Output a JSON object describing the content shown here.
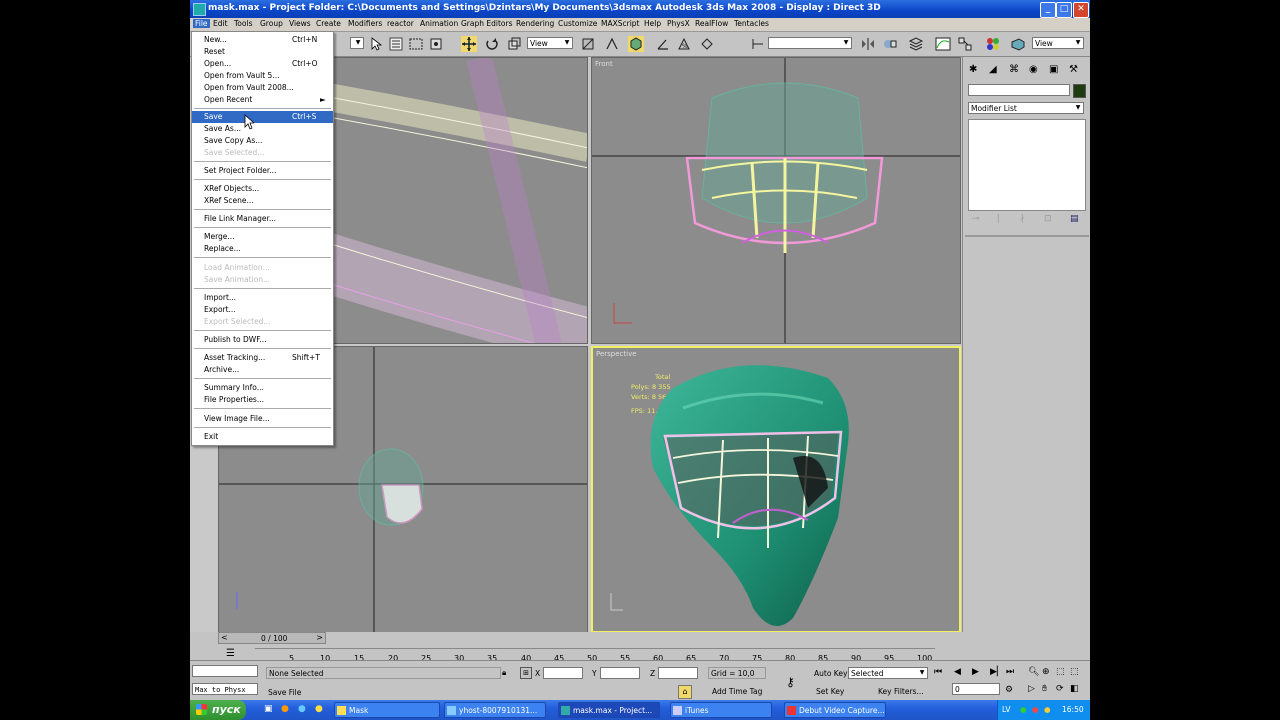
{
  "window": {
    "title": "mask.max     - Project Folder: C:\\Documents and Settings\\Dzintars\\My Documents\\3dsmax        Autodesk 3ds Max 2008        - Display : Direct 3D",
    "minimize": "_",
    "maximize": "□",
    "close": "✕"
  },
  "menubar": [
    "File",
    "Edit",
    "Tools",
    "Group",
    "Views",
    "Create",
    "Modifiers",
    "reactor",
    "Animation",
    "Graph Editors",
    "Rendering",
    "Customize",
    "MAXScript",
    "Help",
    "PhysX",
    "RealFlow",
    "Tentacles"
  ],
  "toolbar": {
    "view_combo": "View",
    "view_combo_right": "View"
  },
  "file_menu": [
    {
      "label": "New...",
      "shortcut": "Ctrl+N",
      "enabled": true
    },
    {
      "label": "Reset",
      "shortcut": "",
      "enabled": true
    },
    {
      "label": "Open...",
      "shortcut": "Ctrl+O",
      "enabled": true
    },
    {
      "label": "Open from Vault 5...",
      "shortcut": "",
      "enabled": true
    },
    {
      "label": "Open from Vault 2008...",
      "shortcut": "",
      "enabled": true
    },
    {
      "label": "Open Recent",
      "shortcut": "►",
      "enabled": true
    },
    {
      "label": "Save",
      "shortcut": "Ctrl+S",
      "enabled": true,
      "highlighted": true
    },
    {
      "label": "Save As...",
      "shortcut": "",
      "enabled": true
    },
    {
      "label": "Save Copy As...",
      "shortcut": "",
      "enabled": true
    },
    {
      "label": "Save Selected...",
      "shortcut": "",
      "enabled": false
    },
    {
      "label": "Set Project Folder...",
      "shortcut": "",
      "enabled": true
    },
    {
      "label": "XRef Objects...",
      "shortcut": "",
      "enabled": true
    },
    {
      "label": "XRef Scene...",
      "shortcut": "",
      "enabled": true
    },
    {
      "label": "File Link Manager...",
      "shortcut": "",
      "enabled": true
    },
    {
      "label": "Merge...",
      "shortcut": "",
      "enabled": true
    },
    {
      "label": "Replace...",
      "shortcut": "",
      "enabled": true
    },
    {
      "label": "Load Animation...",
      "shortcut": "",
      "enabled": false
    },
    {
      "label": "Save Animation...",
      "shortcut": "",
      "enabled": false
    },
    {
      "label": "Import...",
      "shortcut": "",
      "enabled": true
    },
    {
      "label": "Export...",
      "shortcut": "",
      "enabled": true
    },
    {
      "label": "Export Selected...",
      "shortcut": "",
      "enabled": false
    },
    {
      "label": "Publish to DWF...",
      "shortcut": "",
      "enabled": true
    },
    {
      "label": "Asset Tracking...",
      "shortcut": "Shift+T",
      "enabled": true
    },
    {
      "label": "Archive...",
      "shortcut": "",
      "enabled": true
    },
    {
      "label": "Summary Info...",
      "shortcut": "",
      "enabled": true
    },
    {
      "label": "File Properties...",
      "shortcut": "",
      "enabled": true
    },
    {
      "label": "View Image File...",
      "shortcut": "",
      "enabled": true
    },
    {
      "label": "Exit",
      "shortcut": "",
      "enabled": true
    }
  ],
  "viewports": {
    "front": "Front",
    "perspective": "Perspective",
    "stats": {
      "total_label": "Total",
      "polys_label": "Polys:",
      "polys_value": "8 355",
      "verts_label": "Verts:",
      "verts_value": "8 565",
      "fps_label": "FPS:",
      "fps_value": "11.63 307"
    }
  },
  "command_panel": {
    "name_field": "",
    "modifier_list": "Modifier List"
  },
  "timeline": {
    "frame_counter": "0 / 100",
    "ticks": [
      "5",
      "10",
      "15",
      "20",
      "25",
      "30",
      "35",
      "40",
      "45",
      "50",
      "55",
      "60",
      "65",
      "70",
      "75",
      "80",
      "85",
      "90",
      "95",
      "100"
    ]
  },
  "status": {
    "selection": "None Selected",
    "prompt": "Save File",
    "maxscript": "Max to Physx",
    "x_label": "X",
    "y_label": "Y",
    "z_label": "Z",
    "grid": "Grid = 10,0",
    "add_time_tag": "Add Time Tag",
    "auto_key": "Auto Key",
    "set_key": "Set Key",
    "key_mode": "Selected",
    "key_filters": "Key Filters...",
    "current_frame": "0"
  },
  "taskbar": {
    "start": "пуск",
    "tasks": [
      "Mask",
      "yhost-8007910131...",
      "mask.max - Project...",
      "iTunes",
      "Debut Video Capture..."
    ],
    "language": "LV",
    "clock": "16:50"
  }
}
